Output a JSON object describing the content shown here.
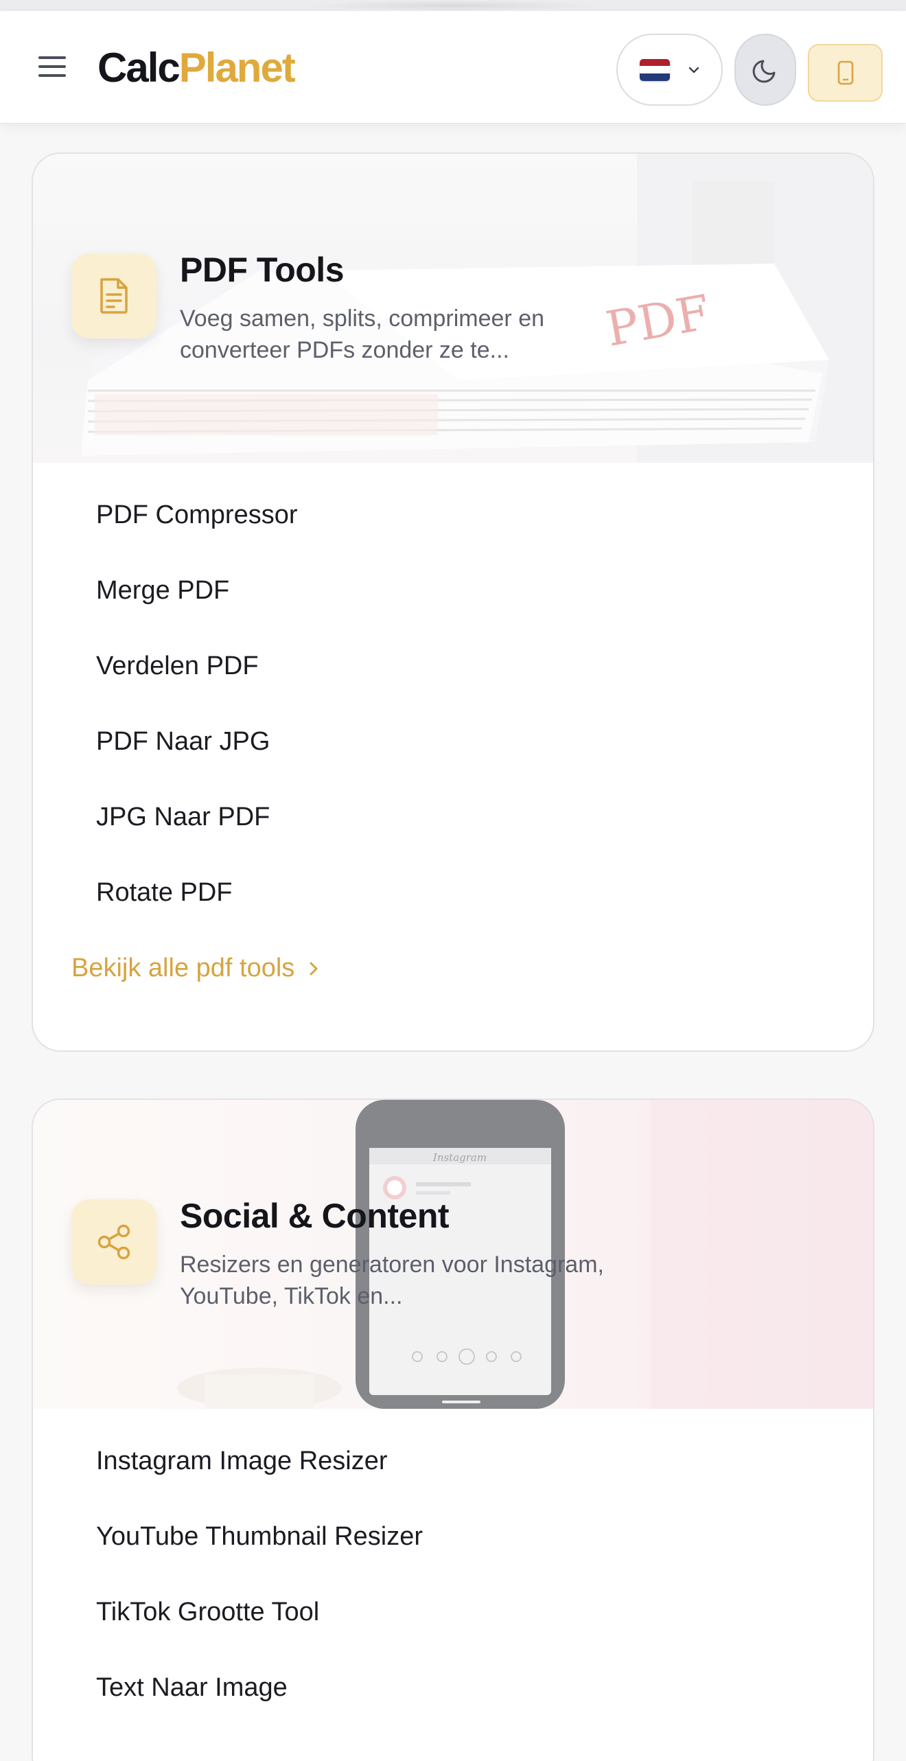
{
  "header": {
    "logo_part1": "Calc",
    "logo_part2": "Planet",
    "menu_icon": "hamburger-icon",
    "language_flag": "netherlands-flag",
    "theme_icon": "moon-icon",
    "device_icon": "smartphone-icon"
  },
  "colors": {
    "accent": "#e0a93b",
    "link": "#d6a43f",
    "icon_bg": "#fbefd2"
  },
  "categories": [
    {
      "title": "PDF Tools",
      "description": "Voeg samen, splits, comprimeer en converteer PDFs zonder ze te...",
      "icon": "document-icon",
      "hero_text": "PDF",
      "tools": [
        "PDF Compressor",
        "Merge PDF",
        "Verdelen PDF",
        "PDF Naar JPG",
        "JPG Naar PDF",
        "Rotate PDF"
      ],
      "view_all": "Bekijk alle pdf tools"
    },
    {
      "title": "Social & Content",
      "description": "Resizers en generatoren voor Instagram, YouTube, TikTok en...",
      "icon": "share-icon",
      "hero_text": "Instagram",
      "tools": [
        "Instagram Image Resizer",
        "YouTube Thumbnail Resizer",
        "TikTok Grootte Tool",
        "Text Naar Image"
      ]
    }
  ]
}
